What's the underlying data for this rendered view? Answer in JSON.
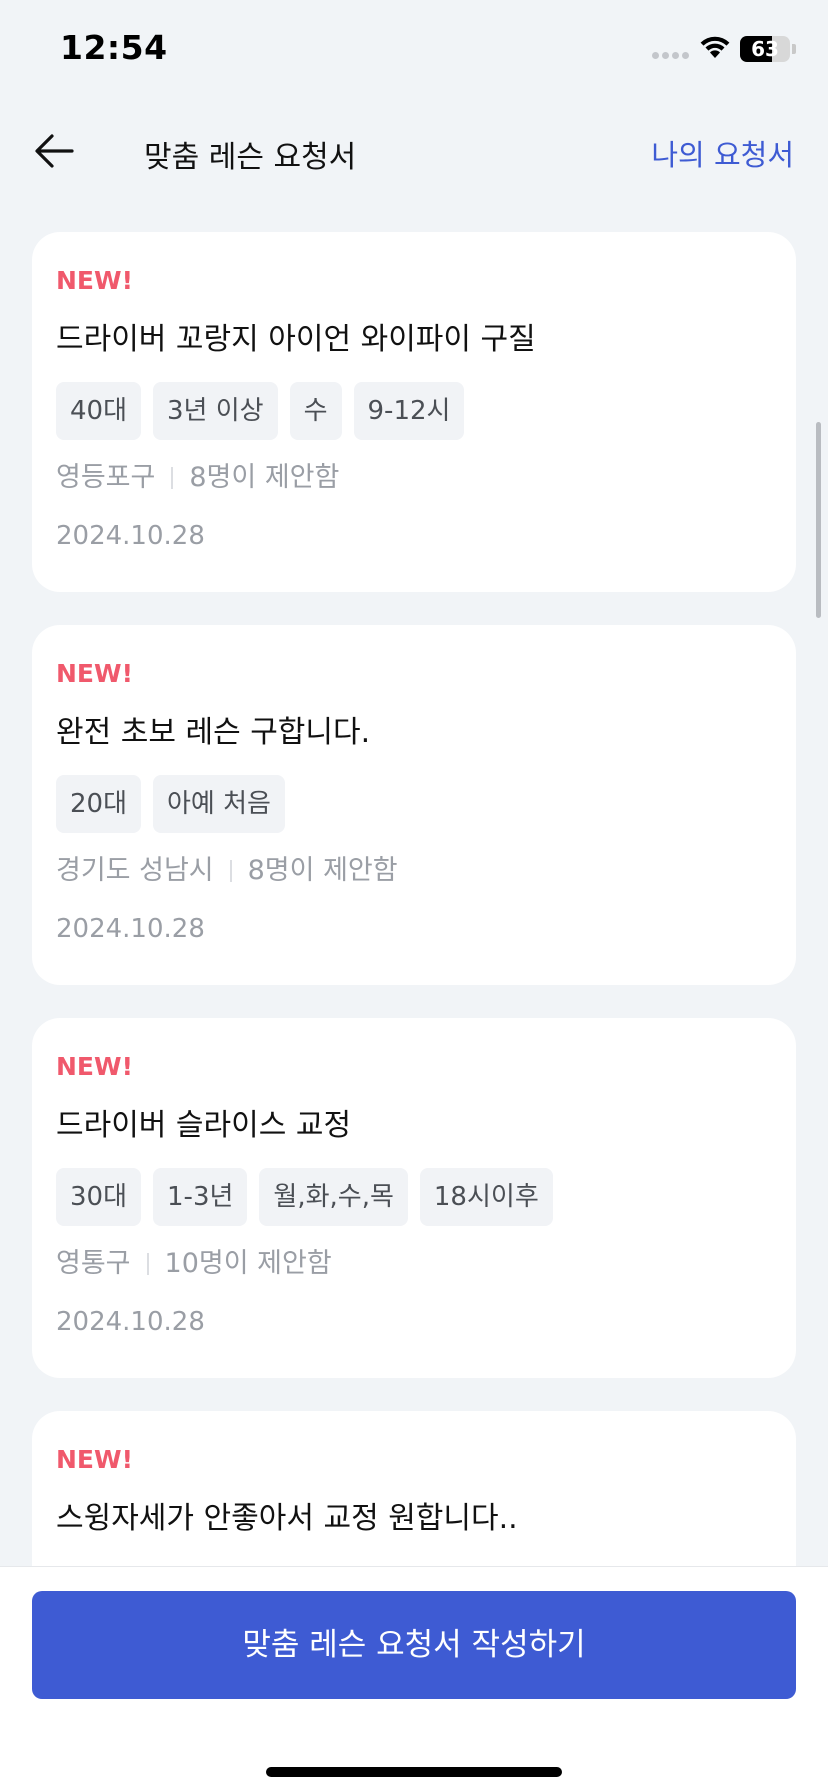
{
  "status_bar": {
    "time": "12:54",
    "battery_level": 63,
    "battery_text": "63",
    "signal_icon": "signal-dots-icon",
    "wifi_icon": "wifi-icon"
  },
  "header": {
    "back_icon": "arrow-left-icon",
    "title": "맞춤 레슨 요청서",
    "my_requests_label": "나의 요청서"
  },
  "requests": [
    {
      "badge": "NEW!",
      "title": "드라이버 꼬랑지 아이언 와이파이 구질",
      "tags": [
        "40대",
        "3년 이상",
        "수",
        "9-12시"
      ],
      "location": "영등포구",
      "proposals": "8명이 제안함",
      "date": "2024.10.28"
    },
    {
      "badge": "NEW!",
      "title": "완전 초보 레슨 구합니다.",
      "tags": [
        "20대",
        "아예 처음"
      ],
      "location": "경기도 성남시",
      "proposals": "8명이 제안함",
      "date": "2024.10.28"
    },
    {
      "badge": "NEW!",
      "title": "드라이버 슬라이스 교정",
      "tags": [
        "30대",
        "1-3년",
        "월,화,수,목",
        "18시이후"
      ],
      "location": "영통구",
      "proposals": "10명이 제안함",
      "date": "2024.10.28"
    },
    {
      "badge": "NEW!",
      "title": "스윙자세가 안좋아서 교정 원합니다..",
      "tags": [],
      "location": "",
      "proposals": "",
      "date": ""
    }
  ],
  "bottom": {
    "write_button_label": "맞춤 레슨 요청서 작성하기"
  },
  "colors": {
    "accent": "#3e5bd3",
    "new_badge": "#f0596c",
    "background": "#f1f4f7"
  }
}
